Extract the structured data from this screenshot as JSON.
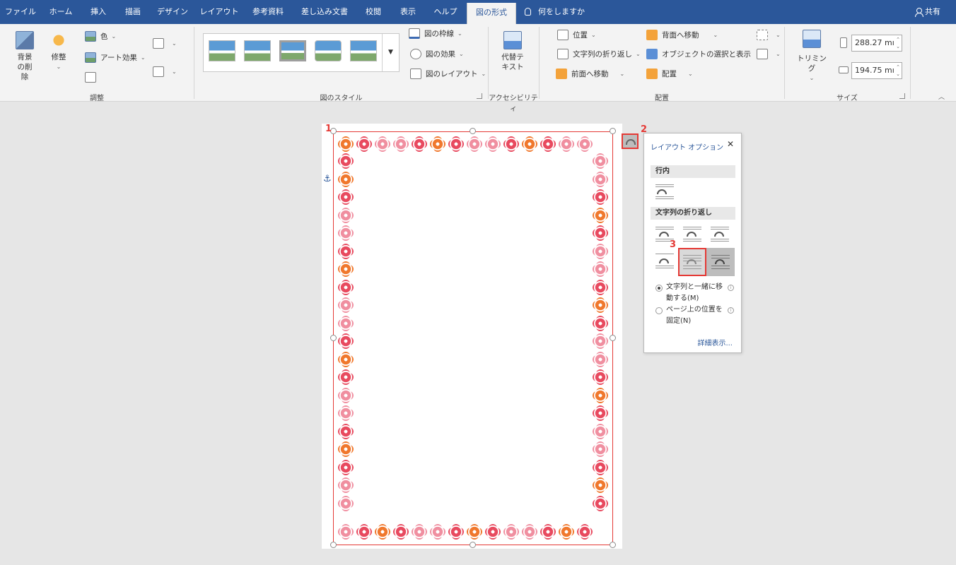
{
  "tabs": [
    "ファイル",
    "ホーム",
    "挿入",
    "描画",
    "デザイン",
    "レイアウト",
    "参考資料",
    "差し込み文書",
    "校閲",
    "表示",
    "ヘルプ",
    "図の形式"
  ],
  "tell_me": "何をしますか",
  "share": "共有",
  "ribbon": {
    "adjust": {
      "remove_bg": "背景の削除",
      "corrections": "修整",
      "color": "色",
      "artistic": "アート効果",
      "label": "調整"
    },
    "picture_styles": {
      "border": "図の枠線",
      "effects": "図の効果",
      "layout": "図のレイアウト",
      "label": "図のスタイル"
    },
    "accessibility": {
      "alt_text": "代替テキスト",
      "label": "アクセシビリティ"
    },
    "arrange": {
      "position": "位置",
      "wrap_text": "文字列の折り返し",
      "bring_forward": "前面へ移動",
      "send_backward": "背面へ移動",
      "selection_pane": "オブジェクトの選択と表示",
      "align": "配置",
      "label": "配置"
    },
    "size": {
      "crop": "トリミング",
      "height": "288.27 mı",
      "width": "194.75 mı",
      "label": "サイズ"
    }
  },
  "steps": [
    "1",
    "2",
    "3"
  ],
  "layout_panel": {
    "title": "レイアウト オプション",
    "close": "✕",
    "inline_header": "行内",
    "wrap_header": "文字列の折り返し",
    "move_with_text": "文字列と一緒に移動する(M)",
    "fix_position": "ページ上の位置を固定(N)",
    "more": "詳細表示..."
  },
  "colors": {
    "titlebar": "#2b579a",
    "flower_red": "#e84a5f",
    "flower_pink": "#f08fa0",
    "flower_orange": "#f0782d",
    "highlight": "#e53935"
  }
}
